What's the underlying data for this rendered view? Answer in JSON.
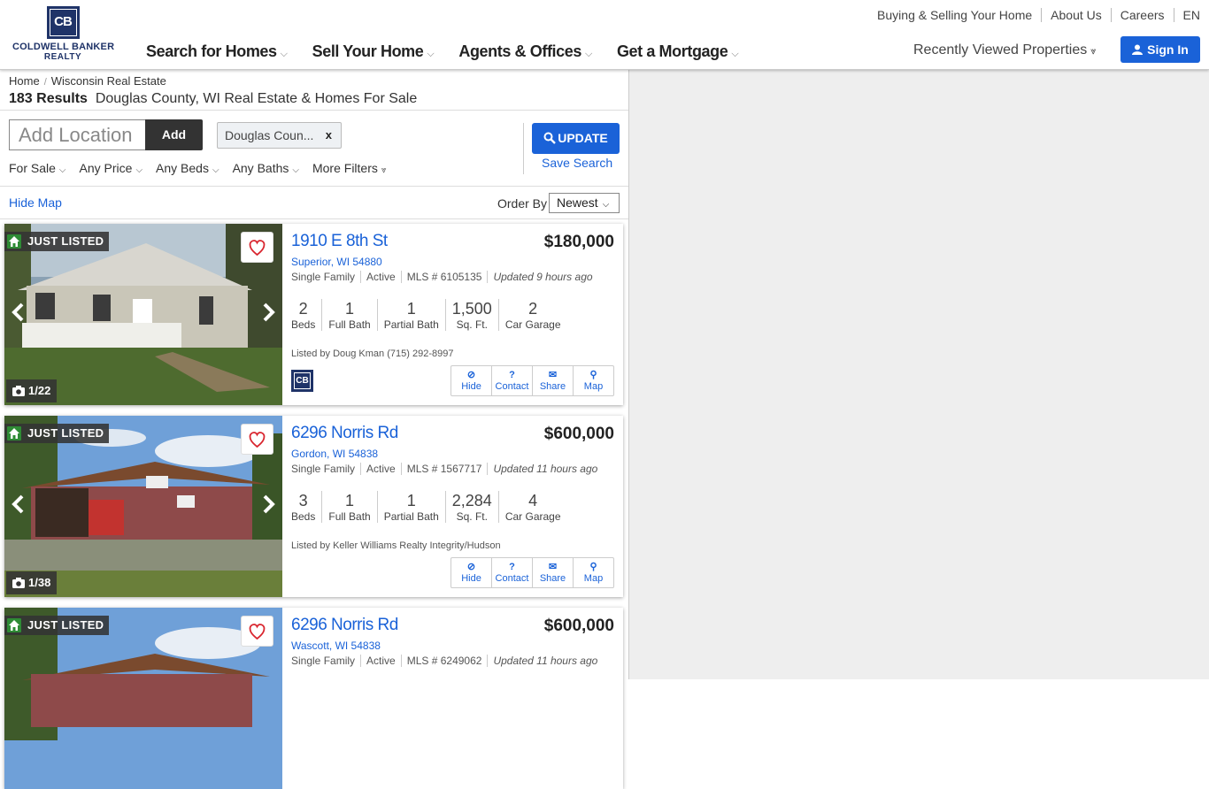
{
  "brand": {
    "logo_mark": "CB",
    "line1": "COLDWELL BANKER",
    "line2": "REALTY"
  },
  "nav": {
    "main": [
      "Search for Homes",
      "Sell Your Home",
      "Agents & Offices",
      "Get a Mortgage"
    ],
    "top": [
      "Buying & Selling Your Home",
      "About Us",
      "Careers",
      "EN"
    ],
    "recently_viewed": "Recently Viewed Properties",
    "sign_in": "Sign In"
  },
  "breadcrumb": [
    "Home",
    "Wisconsin Real Estate"
  ],
  "results": {
    "count": "183 Results",
    "title": "Douglas County, WI Real Estate & Homes For Sale"
  },
  "search": {
    "location_placeholder": "Add Location",
    "add_label": "Add",
    "chip": "Douglas Coun...",
    "chip_close": "x",
    "update_label": "UPDATE",
    "save_search": "Save Search",
    "filters": [
      "For Sale",
      "Any Price",
      "Any Beds",
      "Any Baths",
      "More Filters"
    ]
  },
  "list_controls": {
    "hide_map": "Hide Map",
    "order_by": "Order By",
    "order_value": "Newest"
  },
  "listings": [
    {
      "badge": "JUST LISTED",
      "photo_count": "1/22",
      "address": "1910 E 8th St",
      "price": "$180,000",
      "city": "Superior, WI 54880",
      "type": "Single Family",
      "status": "Active",
      "mls": "MLS # 6105135",
      "updated": "Updated 9 hours ago",
      "stats": [
        {
          "n": "2",
          "l": "Beds"
        },
        {
          "n": "1",
          "l": "Full Bath"
        },
        {
          "n": "1",
          "l": "Partial Bath"
        },
        {
          "n": "1,500",
          "l": "Sq. Ft."
        },
        {
          "n": "2",
          "l": "Car Garage"
        }
      ],
      "listed_by": "Listed by Doug Kman (715) 292-8997",
      "cb_mark": "CB",
      "actions": [
        "Hide",
        "Contact",
        "Share",
        "Map"
      ]
    },
    {
      "badge": "JUST LISTED",
      "photo_count": "1/38",
      "address": "6296 Norris Rd",
      "price": "$600,000",
      "city": "Gordon, WI 54838",
      "type": "Single Family",
      "status": "Active",
      "mls": "MLS # 1567717",
      "updated": "Updated 11 hours ago",
      "stats": [
        {
          "n": "3",
          "l": "Beds"
        },
        {
          "n": "1",
          "l": "Full Bath"
        },
        {
          "n": "1",
          "l": "Partial Bath"
        },
        {
          "n": "2,284",
          "l": "Sq. Ft."
        },
        {
          "n": "4",
          "l": "Car Garage"
        }
      ],
      "listed_by": "Listed by Keller Williams Realty Integrity/Hudson",
      "actions": [
        "Hide",
        "Contact",
        "Share",
        "Map"
      ]
    },
    {
      "badge": "JUST LISTED",
      "address": "6296 Norris Rd",
      "price": "$600,000",
      "city": "Wascott, WI 54838",
      "type": "Single Family",
      "status": "Active",
      "mls": "MLS # 6249062",
      "updated": "Updated 11 hours ago"
    }
  ],
  "colors": {
    "brand_navy": "#1f3368",
    "accent_blue": "#1a62d8",
    "badge_green": "#2e8b35"
  }
}
